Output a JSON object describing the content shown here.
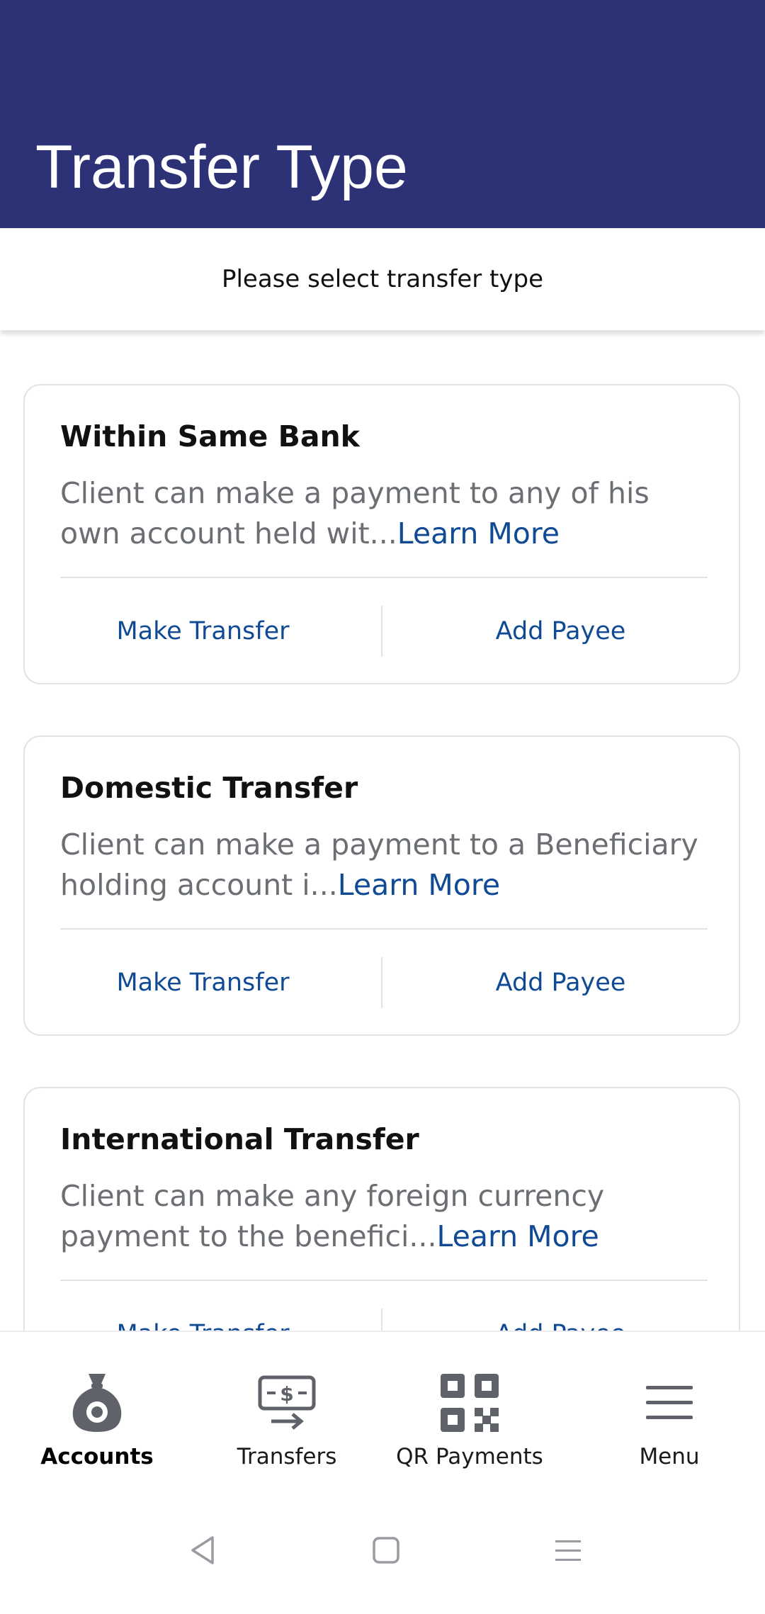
{
  "header": {
    "title": "Transfer Type"
  },
  "subheader": {
    "text": "Please select transfer type"
  },
  "cards": [
    {
      "title": "Within Same Bank",
      "description": "Client can make a payment to any of his own account held wit...",
      "learn_more": "Learn More",
      "make_transfer": "Make Transfer",
      "add_payee": "Add Payee"
    },
    {
      "title": "Domestic Transfer",
      "description": "Client can make a payment to a Beneficiary holding account i...",
      "learn_more": "Learn More",
      "make_transfer": "Make Transfer",
      "add_payee": "Add Payee"
    },
    {
      "title": "International Transfer",
      "description": "Client can make any foreign currency payment to the benefici...",
      "learn_more": "Learn More",
      "make_transfer": "Make Transfer",
      "add_payee": "Add Payee"
    }
  ],
  "bottom_nav": {
    "items": [
      {
        "label": "Accounts",
        "icon": "money-bag-icon",
        "active": true
      },
      {
        "label": "Transfers",
        "icon": "transfer-money-icon",
        "active": false
      },
      {
        "label": "QR Payments",
        "icon": "qr-code-icon",
        "active": false
      },
      {
        "label": "Menu",
        "icon": "hamburger-menu-icon",
        "active": false
      }
    ]
  },
  "system_nav": {
    "icons": [
      "back-icon",
      "home-icon",
      "recents-icon"
    ]
  },
  "colors": {
    "header_bg": "#2c3275",
    "link": "#114a94",
    "text_muted": "#6b6f74",
    "icon_gray": "#5f6268"
  }
}
